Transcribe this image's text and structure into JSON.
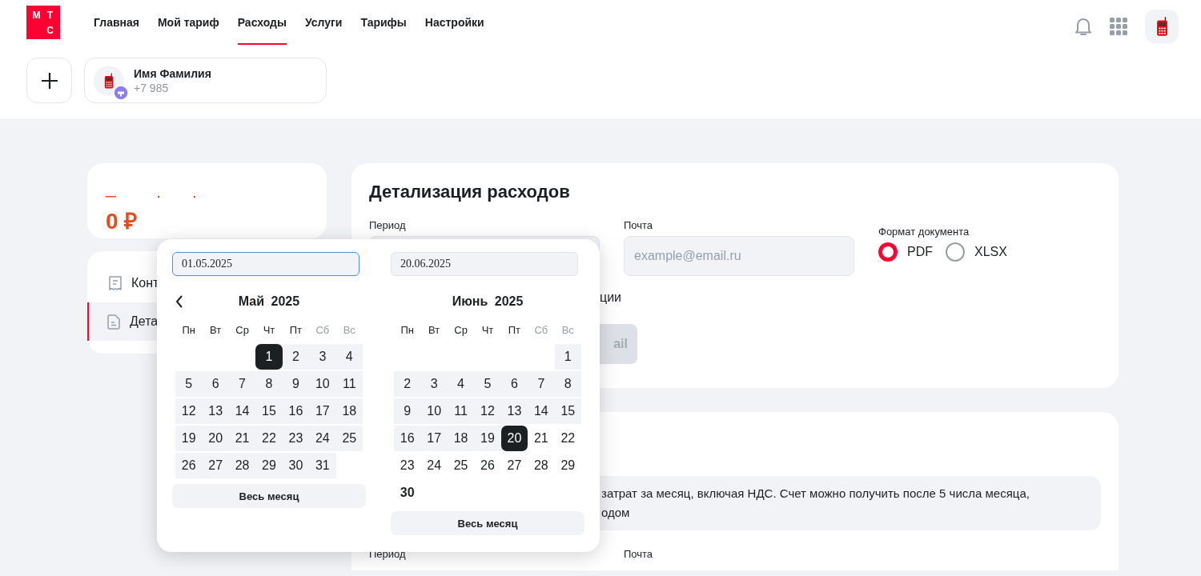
{
  "logo": {
    "letters": [
      "М",
      "Т",
      "С"
    ]
  },
  "nav": [
    {
      "label": "Главная",
      "selected": false
    },
    {
      "label": "Мой тариф",
      "selected": false
    },
    {
      "label": "Расходы",
      "selected": true
    },
    {
      "label": "Услуги",
      "selected": false
    },
    {
      "label": "Тарифы",
      "selected": false
    },
    {
      "label": "Настройки",
      "selected": false
    }
  ],
  "profile": {
    "name": "Имя Фамилия",
    "phone": "+7 985"
  },
  "balance": {
    "amount": "0 ₽"
  },
  "sidebar": {
    "items": [
      {
        "label": "Конт",
        "kind": "receipt",
        "selected": false
      },
      {
        "label": "Дета",
        "kind": "document",
        "selected": true
      }
    ]
  },
  "details": {
    "title": "Детализация расходов",
    "period_label": "Период",
    "email_label": "Почта",
    "email_placeholder": "example@email.ru",
    "format_label": "Формат документа",
    "formats": [
      {
        "label": "PDF",
        "selected": true
      },
      {
        "label": "XLSX",
        "selected": false
      }
    ],
    "option_text": "ции",
    "send_button": {
      "label": "ail",
      "disabled": true
    }
  },
  "invoice": {
    "info_lines": [
      "затрат за месяц, включая НДС. Счет можно получить после 5 числа месяца,",
      "одом"
    ],
    "period_label": "Период",
    "email_label": "Почта"
  },
  "date_picker": {
    "fields": [
      {
        "value": "01.05.2025",
        "focused": true
      },
      {
        "value": "20.06.2025",
        "focused": false
      }
    ],
    "months": [
      {
        "title": "Май 2025",
        "prev_arrow": true,
        "button": "Весь месяц",
        "weekdays": [
          {
            "label": "Пн",
            "weekend": false
          },
          {
            "label": "Вт",
            "weekend": false
          },
          {
            "label": "Ср",
            "weekend": false
          },
          {
            "label": "Чт",
            "weekend": false
          },
          {
            "label": "Пт",
            "weekend": false
          },
          {
            "label": "Сб",
            "weekend": true
          },
          {
            "label": "Вс",
            "weekend": true
          }
        ],
        "weeks": [
          [
            {
              "day": "1",
              "in_range": true,
              "selected": true,
              "today": false
            },
            {
              "day": "2",
              "in_range": true,
              "selected": false,
              "today": false
            },
            {
              "day": "3",
              "in_range": true,
              "selected": false,
              "today": false
            },
            {
              "day": "4",
              "in_range": true,
              "selected": false,
              "today": false
            }
          ],
          [
            {
              "day": "5",
              "in_range": true,
              "selected": false,
              "today": false
            },
            {
              "day": "6",
              "in_range": true,
              "selected": false,
              "today": false
            },
            {
              "day": "7",
              "in_range": true,
              "selected": false,
              "today": false
            },
            {
              "day": "8",
              "in_range": true,
              "selected": false,
              "today": false
            },
            {
              "day": "9",
              "in_range": true,
              "selected": false,
              "today": false
            },
            {
              "day": "10",
              "in_range": true,
              "selected": false,
              "today": false
            },
            {
              "day": "11",
              "in_range": true,
              "selected": false,
              "today": false
            }
          ],
          [
            {
              "day": "12",
              "in_range": true,
              "selected": false,
              "today": false
            },
            {
              "day": "13",
              "in_range": true,
              "selected": false,
              "today": false
            },
            {
              "day": "14",
              "in_range": true,
              "selected": false,
              "today": false
            },
            {
              "day": "15",
              "in_range": true,
              "selected": false,
              "today": false
            },
            {
              "day": "16",
              "in_range": true,
              "selected": false,
              "today": false
            },
            {
              "day": "17",
              "in_range": true,
              "selected": false,
              "today": false
            },
            {
              "day": "18",
              "in_range": true,
              "selected": false,
              "today": false
            }
          ],
          [
            {
              "day": "19",
              "in_range": true,
              "selected": false,
              "today": false
            },
            {
              "day": "20",
              "in_range": true,
              "selected": false,
              "today": false
            },
            {
              "day": "21",
              "in_range": true,
              "selected": false,
              "today": false
            },
            {
              "day": "22",
              "in_range": true,
              "selected": false,
              "today": false
            },
            {
              "day": "23",
              "in_range": true,
              "selected": false,
              "today": false
            },
            {
              "day": "24",
              "in_range": true,
              "selected": false,
              "today": false
            },
            {
              "day": "25",
              "in_range": true,
              "selected": false,
              "today": false
            }
          ],
          [
            {
              "day": "26",
              "in_range": true,
              "selected": false,
              "today": false
            },
            {
              "day": "27",
              "in_range": true,
              "selected": false,
              "today": false
            },
            {
              "day": "28",
              "in_range": true,
              "selected": false,
              "today": false
            },
            {
              "day": "29",
              "in_range": true,
              "selected": false,
              "today": false
            },
            {
              "day": "30",
              "in_range": true,
              "selected": false,
              "today": false
            },
            {
              "day": "31",
              "in_range": true,
              "selected": false,
              "today": false
            }
          ]
        ]
      },
      {
        "title": "Июнь 2025",
        "prev_arrow": false,
        "button": "Весь месяц",
        "weekdays": [
          {
            "label": "Пн",
            "weekend": false
          },
          {
            "label": "Вт",
            "weekend": false
          },
          {
            "label": "Ср",
            "weekend": false
          },
          {
            "label": "Чт",
            "weekend": false
          },
          {
            "label": "Пт",
            "weekend": false
          },
          {
            "label": "Сб",
            "weekend": true
          },
          {
            "label": "Вс",
            "weekend": true
          }
        ],
        "weeks": [
          [
            {
              "day": "1",
              "in_range": true,
              "selected": false,
              "today": false
            }
          ],
          [
            {
              "day": "2",
              "in_range": true,
              "selected": false,
              "today": false
            },
            {
              "day": "3",
              "in_range": true,
              "selected": false,
              "today": false
            },
            {
              "day": "4",
              "in_range": true,
              "selected": false,
              "today": false
            },
            {
              "day": "5",
              "in_range": true,
              "selected": false,
              "today": false
            },
            {
              "day": "6",
              "in_range": true,
              "selected": false,
              "today": false
            },
            {
              "day": "7",
              "in_range": true,
              "selected": false,
              "today": false
            },
            {
              "day": "8",
              "in_range": true,
              "selected": false,
              "today": false
            }
          ],
          [
            {
              "day": "9",
              "in_range": true,
              "selected": false,
              "today": false
            },
            {
              "day": "10",
              "in_range": true,
              "selected": false,
              "today": false
            },
            {
              "day": "11",
              "in_range": true,
              "selected": false,
              "today": false
            },
            {
              "day": "12",
              "in_range": true,
              "selected": false,
              "today": false
            },
            {
              "day": "13",
              "in_range": true,
              "selected": false,
              "today": false
            },
            {
              "day": "14",
              "in_range": true,
              "selected": false,
              "today": false
            },
            {
              "day": "15",
              "in_range": true,
              "selected": false,
              "today": false
            }
          ],
          [
            {
              "day": "16",
              "in_range": true,
              "selected": false,
              "today": false
            },
            {
              "day": "17",
              "in_range": true,
              "selected": false,
              "today": false
            },
            {
              "day": "18",
              "in_range": true,
              "selected": false,
              "today": false
            },
            {
              "day": "19",
              "in_range": true,
              "selected": false,
              "today": false
            },
            {
              "day": "20",
              "in_range": true,
              "selected": true,
              "today": false
            },
            {
              "day": "21",
              "in_range": false,
              "selected": false,
              "today": false
            },
            {
              "day": "22",
              "in_range": false,
              "selected": false,
              "today": false
            }
          ],
          [
            {
              "day": "23",
              "in_range": false,
              "selected": false,
              "today": false
            },
            {
              "day": "24",
              "in_range": false,
              "selected": false,
              "today": false
            },
            {
              "day": "25",
              "in_range": false,
              "selected": false,
              "today": false
            },
            {
              "day": "26",
              "in_range": false,
              "selected": false,
              "today": false
            },
            {
              "day": "27",
              "in_range": false,
              "selected": false,
              "today": false
            },
            {
              "day": "28",
              "in_range": false,
              "selected": false,
              "today": false
            },
            {
              "day": "29",
              "in_range": false,
              "selected": false,
              "today": false
            }
          ],
          [
            {
              "day": "30",
              "in_range": false,
              "selected": false,
              "today": true
            }
          ]
        ]
      }
    ]
  }
}
